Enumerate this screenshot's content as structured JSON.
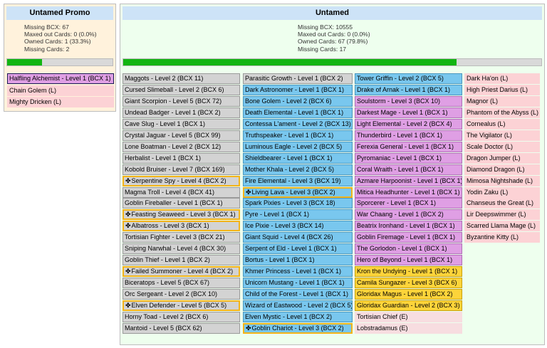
{
  "promo": {
    "title": "Untamed Promo",
    "stats": [
      "Missing BCX: 67",
      "Maxed out Cards: 0 (0.0%)",
      "Owned Cards: 1 (33.3%)",
      "Missing Cards: 2"
    ],
    "progress": 0.333,
    "cards": [
      {
        "label": "Halfling Alchemist - Level 1 (BCX 1)",
        "style": "purple",
        "selected": true
      },
      {
        "label": "Chain Golem (L)",
        "style": "pink"
      },
      {
        "label": "Mighty Dricken (L)",
        "style": "pink"
      }
    ]
  },
  "untamed": {
    "title": "Untamed",
    "stats": [
      "Missing BCX: 10555",
      "Maxed out Cards: 0 (0.0%)",
      "Owned Cards: 67 (79.8%)",
      "Missing Cards: 17"
    ],
    "progress": 0.798,
    "columns": [
      [
        {
          "label": "Maggots - Level 2 (BCX 11)",
          "style": "gray"
        },
        {
          "label": "Cursed Slimeball - Level 2 (BCX 6)",
          "style": "gray"
        },
        {
          "label": "Giant Scorpion - Level 5 (BCX 72)",
          "style": "gray"
        },
        {
          "label": "Undead Badger - Level 1 (BCX 2)",
          "style": "gray"
        },
        {
          "label": "Cave Slug - Level 1 (BCX 1)",
          "style": "gray"
        },
        {
          "label": "Crystal Jaguar - Level 5 (BCX 99)",
          "style": "gray"
        },
        {
          "label": "Lone Boatman - Level 2 (BCX 12)",
          "style": "gray"
        },
        {
          "label": "Herbalist - Level 1 (BCX 1)",
          "style": "gray"
        },
        {
          "label": "Kobold Bruiser - Level 7 (BCX 169)",
          "style": "gray"
        },
        {
          "label": "Serpentine Spy - Level 4 (BCX 2)",
          "style": "gray",
          "highlight": true
        },
        {
          "label": "Magma Troll - Level 4 (BCX 41)",
          "style": "gray"
        },
        {
          "label": "Goblin Fireballer - Level 1 (BCX 1)",
          "style": "gray"
        },
        {
          "label": "Feasting Seaweed - Level 3 (BCX 1)",
          "style": "gray",
          "highlight": true
        },
        {
          "label": "Albatross - Level 3 (BCX 1)",
          "style": "gray",
          "highlight": true
        },
        {
          "label": "Tortisian Fighter - Level 3 (BCX 21)",
          "style": "gray"
        },
        {
          "label": "Sniping Narwhal - Level 4 (BCX 30)",
          "style": "gray"
        },
        {
          "label": "Goblin Thief - Level 1 (BCX 2)",
          "style": "gray"
        },
        {
          "label": "Failed Summoner - Level 4 (BCX 2)",
          "style": "gray",
          "highlight": true
        },
        {
          "label": "Biceratops - Level 5 (BCX 67)",
          "style": "gray"
        },
        {
          "label": "Orc Sergeant - Level 2 (BCX 10)",
          "style": "gray"
        },
        {
          "label": "Elven Defender - Level 5 (BCX 5)",
          "style": "gray",
          "highlight": true
        },
        {
          "label": "Horny Toad - Level 2 (BCX 6)",
          "style": "gray"
        },
        {
          "label": "Mantoid - Level 5 (BCX 62)",
          "style": "gray"
        }
      ],
      [
        {
          "label": "Parasitic Growth - Level 1 (BCX 2)",
          "style": "gray"
        },
        {
          "label": "Dark Astronomer - Level 1 (BCX 1)",
          "style": "blue"
        },
        {
          "label": "Bone Golem - Level 2 (BCX 6)",
          "style": "blue"
        },
        {
          "label": "Death Elemental - Level 1 (BCX 1)",
          "style": "blue"
        },
        {
          "label": "Contessa L'ament - Level 2 (BCX 13)",
          "style": "blue"
        },
        {
          "label": "Truthspeaker - Level 1 (BCX 1)",
          "style": "blue"
        },
        {
          "label": "Luminous Eagle - Level 2 (BCX 5)",
          "style": "blue"
        },
        {
          "label": "Shieldbearer - Level 1 (BCX 1)",
          "style": "blue"
        },
        {
          "label": "Mother Khala - Level 2 (BCX 5)",
          "style": "blue"
        },
        {
          "label": "Fire Elemental - Level 3 (BCX 19)",
          "style": "blue"
        },
        {
          "label": "Living Lava - Level 3 (BCX 2)",
          "style": "blue",
          "highlight": true
        },
        {
          "label": "Spark Pixies - Level 3 (BCX 18)",
          "style": "blue"
        },
        {
          "label": "Pyre - Level 1 (BCX 1)",
          "style": "blue"
        },
        {
          "label": "Ice Pixie - Level 3 (BCX 14)",
          "style": "blue"
        },
        {
          "label": "Giant Squid - Level 4 (BCX 26)",
          "style": "blue"
        },
        {
          "label": "Serpent of Eld - Level 1 (BCX 1)",
          "style": "blue"
        },
        {
          "label": "Bortus - Level 1 (BCX 1)",
          "style": "blue"
        },
        {
          "label": "Khmer Princess - Level 1 (BCX 1)",
          "style": "blue"
        },
        {
          "label": "Unicorn Mustang - Level 1 (BCX 1)",
          "style": "blue"
        },
        {
          "label": "Child of the Forest - Level 1 (BCX 1)",
          "style": "blue"
        },
        {
          "label": "Wizard of Eastwood - Level 2 (BCX 5)",
          "style": "blue"
        },
        {
          "label": "Elven Mystic - Level 1 (BCX 2)",
          "style": "blue"
        },
        {
          "label": "Goblin Chariot - Level 3 (BCX 2)",
          "style": "blue",
          "highlight": true
        }
      ],
      [
        {
          "label": "Tower Griffin - Level 2 (BCX 5)",
          "style": "blue"
        },
        {
          "label": "Drake of Arnak - Level 1 (BCX 1)",
          "style": "blue"
        },
        {
          "label": "Soulstorm - Level 3 (BCX 10)",
          "style": "purple"
        },
        {
          "label": "Darkest Mage - Level 1 (BCX 1)",
          "style": "purple"
        },
        {
          "label": "Light Elemental - Level 2 (BCX 4)",
          "style": "purple"
        },
        {
          "label": "Thunderbird - Level 1 (BCX 1)",
          "style": "purple"
        },
        {
          "label": "Ferexia General - Level 1 (BCX 1)",
          "style": "purple"
        },
        {
          "label": "Pyromaniac - Level 1 (BCX 1)",
          "style": "purple"
        },
        {
          "label": "Coral Wraith - Level 1 (BCX 1)",
          "style": "purple"
        },
        {
          "label": "Azmare Harpoonist - Level 1 (BCX 1)",
          "style": "purple"
        },
        {
          "label": "Mitica Headhunter - Level 1 (BCX 1)",
          "style": "purple"
        },
        {
          "label": "Sporcerer - Level 1 (BCX 1)",
          "style": "purple"
        },
        {
          "label": "War Chaang - Level 1 (BCX 2)",
          "style": "purple"
        },
        {
          "label": "Beatrix Ironhand - Level 1 (BCX 1)",
          "style": "purple"
        },
        {
          "label": "Goblin Firemage - Level 1 (BCX 1)",
          "style": "purple"
        },
        {
          "label": "The Gorlodon - Level 1 (BCX 1)",
          "style": "purple"
        },
        {
          "label": "Hero of Beyond - Level 1 (BCX 1)",
          "style": "purple"
        },
        {
          "label": "Kron the Undying - Level 1 (BCX 1)",
          "style": "yellow"
        },
        {
          "label": "Camila Sungazer - Level 3 (BCX 6)",
          "style": "yellow"
        },
        {
          "label": "Gloridax Magus - Level 1 (BCX 2)",
          "style": "yellow"
        },
        {
          "label": "Gloridax Guardian - Level 2 (BCX 3)",
          "style": "yellow"
        },
        {
          "label": "Tortisian Chief (E)",
          "style": "lpink"
        },
        {
          "label": "Lobstradamus (E)",
          "style": "lpink"
        }
      ],
      [
        {
          "label": "Dark Ha'on (L)",
          "style": "pink"
        },
        {
          "label": "High Priest Darius (L)",
          "style": "pink"
        },
        {
          "label": "Magnor (L)",
          "style": "pink"
        },
        {
          "label": "Phantom of the Abyss (L)",
          "style": "pink"
        },
        {
          "label": "Cornealus (L)",
          "style": "pink"
        },
        {
          "label": "The Vigilator (L)",
          "style": "pink"
        },
        {
          "label": "Scale Doctor (L)",
          "style": "pink"
        },
        {
          "label": "Dragon Jumper (L)",
          "style": "pink"
        },
        {
          "label": "Diamond Dragon (L)",
          "style": "pink"
        },
        {
          "label": "Mimosa Nightshade (L)",
          "style": "pink"
        },
        {
          "label": "Yodin Zaku (L)",
          "style": "pink"
        },
        {
          "label": "Chanseus the Great (L)",
          "style": "pink"
        },
        {
          "label": "Lir Deepswimmer (L)",
          "style": "pink"
        },
        {
          "label": "Scarred Llama Mage (L)",
          "style": "pink"
        },
        {
          "label": "Byzantine Kitty (L)",
          "style": "pink"
        }
      ]
    ]
  },
  "highlight_icon": "gold-foil-star-icon",
  "highlight_glyph": "✤"
}
